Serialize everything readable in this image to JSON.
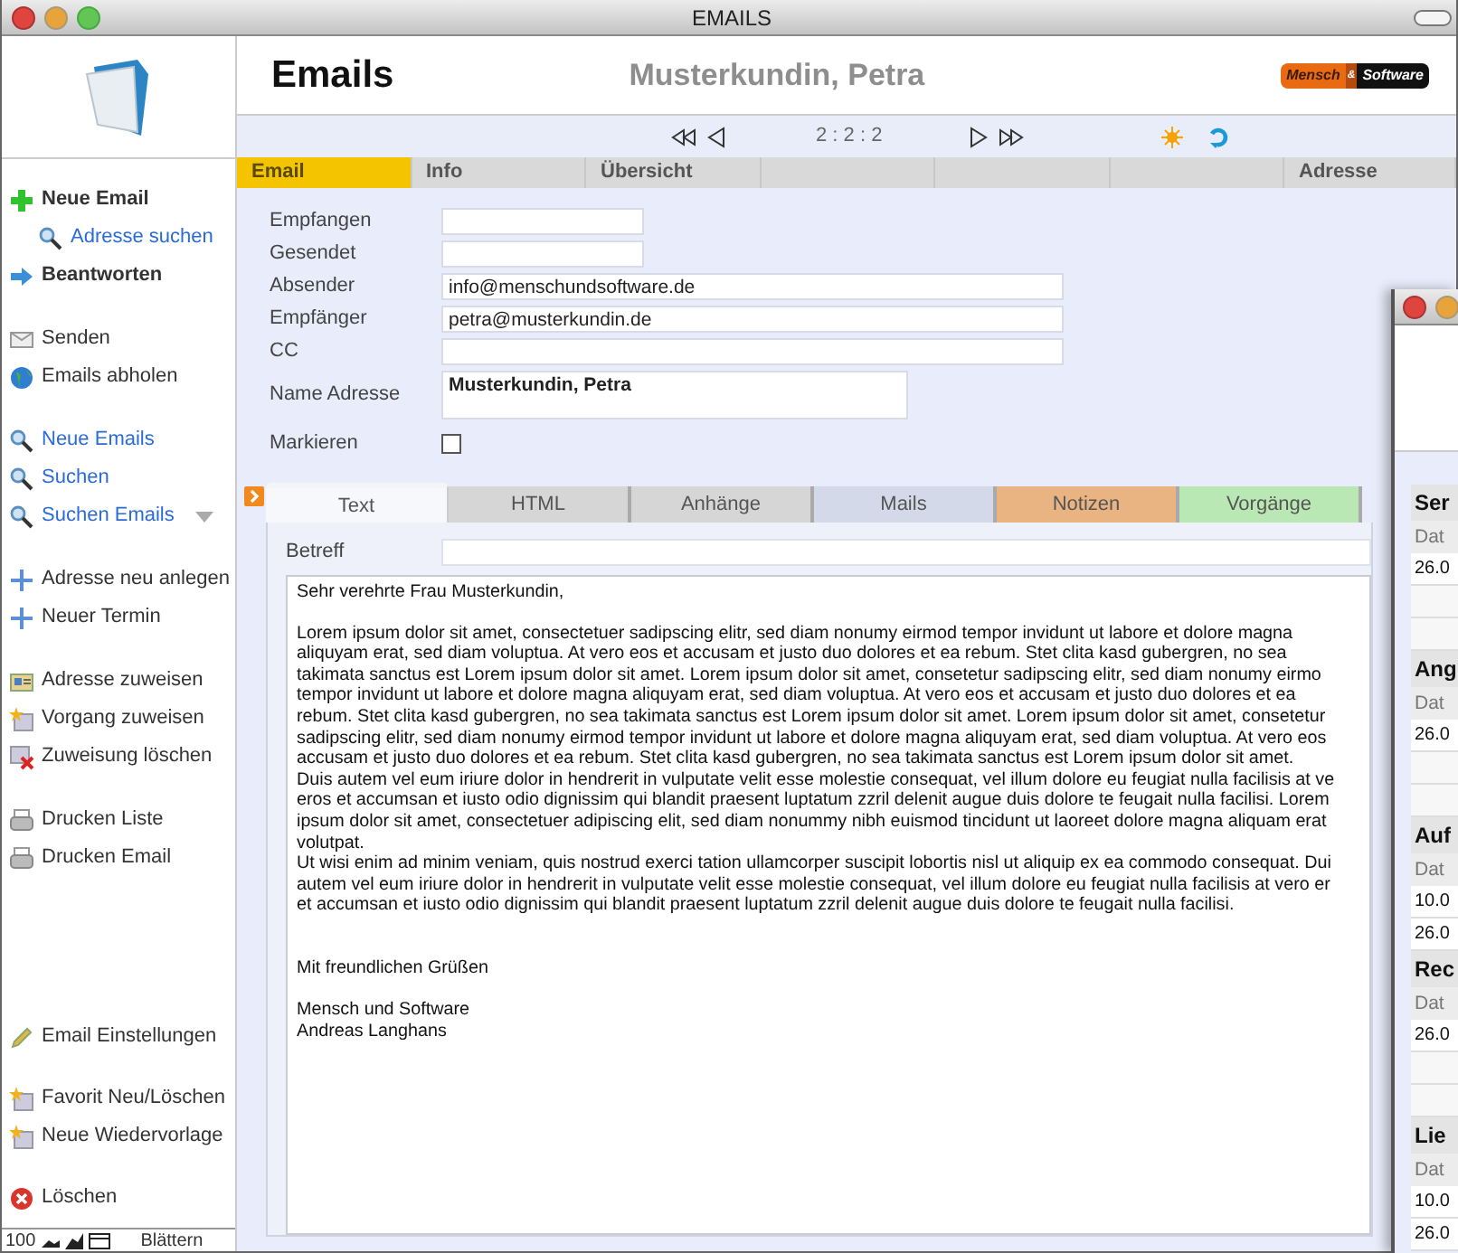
{
  "window": {
    "title": "EMAILS"
  },
  "header": {
    "title": "Emails",
    "contact": "Musterkundin, Petra",
    "logo": [
      "Mensch",
      "&",
      "Software"
    ]
  },
  "nav": {
    "record": "2 : 2 : 2"
  },
  "top_tabs": [
    {
      "label": "Email",
      "selected": true
    },
    {
      "label": "Info",
      "selected": false
    },
    {
      "label": "Übersicht",
      "selected": false
    }
  ],
  "right_tab": {
    "label": "Adresse",
    "selected": false
  },
  "sidebar": {
    "top_groups": [
      [
        {
          "label": "Neue Email",
          "kind": "add",
          "children": [
            {
              "label": "Adresse suchen",
              "kind": "search"
            }
          ]
        },
        {
          "label": "Beantworten",
          "kind": "reply"
        }
      ],
      [
        {
          "label": "Senden",
          "kind": "envelope"
        },
        {
          "label": "Emails abholen",
          "kind": "globe"
        }
      ],
      [
        {
          "label": "Neue Emails",
          "kind": "search"
        },
        {
          "label": "Suchen",
          "kind": "search"
        },
        {
          "label": "Suchen Emails",
          "kind": "search",
          "dropdown": true
        }
      ],
      [
        {
          "label": "Adresse neu anlegen",
          "kind": "cross"
        },
        {
          "label": "Neuer Termin",
          "kind": "cross"
        }
      ],
      [
        {
          "label": "Adresse zuweisen",
          "kind": "card"
        },
        {
          "label": "Vorgang zuweisen",
          "kind": "star"
        },
        {
          "label": "Zuweisung löschen",
          "kind": "unassign"
        }
      ],
      [
        {
          "label": "Drucken Liste",
          "kind": "printer"
        },
        {
          "label": "Drucken Email",
          "kind": "printer"
        }
      ]
    ],
    "bottom_groups": [
      [
        {
          "label": "Email Einstellungen",
          "kind": "pencil"
        }
      ],
      [
        {
          "label": "Favorit Neu/Löschen",
          "kind": "star"
        },
        {
          "label": "Neue Wiedervorlage",
          "kind": "star"
        }
      ],
      [
        {
          "label": "Löschen",
          "kind": "delete"
        }
      ]
    ]
  },
  "form": [
    {
      "label": "Empfangen",
      "kind": "short"
    },
    {
      "label": "Gesendet",
      "kind": "short"
    },
    {
      "label": "Absender",
      "kind": "long",
      "value": "info@menschundsoftware.de"
    },
    {
      "label": "Empfänger",
      "kind": "long",
      "value": "petra@musterkundin.de"
    },
    {
      "label": "CC",
      "kind": "long"
    },
    {
      "label": "Name Adresse",
      "kind": "area",
      "value": "Musterkundin, Petra"
    },
    {
      "label": "Markieren",
      "kind": "checkbox",
      "checked": false
    }
  ],
  "detail_tabs": [
    {
      "label": "Text",
      "selected": true,
      "color": "#f4f5f8"
    },
    {
      "label": "HTML",
      "selected": false,
      "color": "#d6d6d6"
    },
    {
      "label": "Anhänge",
      "selected": false,
      "color": "#d6d6d6"
    },
    {
      "label": "Mails",
      "selected": false,
      "color": "#d3d9e8"
    },
    {
      "label": "Notizen",
      "selected": false,
      "color": "#e9b482"
    },
    {
      "label": "Vorgänge",
      "selected": false,
      "color": "#b9e8b5"
    }
  ],
  "subject_label": "Betreff",
  "body": "Sehr verehrte Frau Musterkundin,\n\nLorem ipsum dolor sit amet, consectetuer sadipscing elitr, sed diam nonumy eirmod tempor invidunt ut labore et dolore magna\naliquyam erat, sed diam voluptua. At vero eos et accusam et justo duo dolores et ea rebum. Stet clita kasd gubergren, no sea\ntakimata sanctus est Lorem ipsum dolor sit amet. Lorem ipsum dolor sit amet, consetetur sadipscing elitr, sed diam nonumy eirmo\ntempor invidunt ut labore et dolore magna aliquyam erat, sed diam voluptua. At vero eos et accusam et justo duo dolores et ea\nrebum. Stet clita kasd gubergren, no sea takimata sanctus est Lorem ipsum dolor sit amet. Lorem ipsum dolor sit amet, consetetur\nsadipscing elitr, sed diam nonumy eirmod tempor invidunt ut labore et dolore magna aliquyam erat, sed diam voluptua. At vero eos\naccusam et justo duo dolores et ea rebum. Stet clita kasd gubergren, no sea takimata sanctus est Lorem ipsum dolor sit amet.\nDuis autem vel eum iriure dolor in hendrerit in vulputate velit esse molestie consequat, vel illum dolore eu feugiat nulla facilisis at ve\neros et accumsan et iusto odio dignissim qui blandit praesent luptatum zzril delenit augue duis dolore te feugait nulla facilisi. Lorem\nipsum dolor sit amet, consectetuer adipiscing elit, sed diam nonummy nibh euismod tincidunt ut laoreet dolore magna aliquam erat\nvolutpat.\nUt wisi enim ad minim veniam, quis nostrud exerci tation ullamcorper suscipit lobortis nisl ut aliquip ex ea commodo consequat. Dui\nautem vel eum iriure dolor in hendrerit in vulputate velit esse molestie consequat, vel illum dolore eu feugiat nulla facilisis at vero er\net accumsan et iusto odio dignissim qui blandit praesent luptatum zzril delenit augue duis dolore te feugait nulla facilisi.\n\n\nMit freundlichen Grüßen\n\nMensch und Software\nAndreas Langhans",
  "status_bar": {
    "zoom": "100",
    "mode": "Blättern"
  },
  "second_window": {
    "sections": [
      {
        "title": "Ser",
        "column_1": "Dat",
        "rows": [
          "26.0"
        ]
      },
      {
        "title": "Ang",
        "column_1": "Dat",
        "rows": [
          "26.0"
        ]
      },
      {
        "title": "Auf",
        "column_1": "Dat",
        "rows": [
          "10.0",
          "26.0"
        ]
      },
      {
        "title": "Rec",
        "column_1": "Dat",
        "rows": [
          "26.0"
        ]
      },
      {
        "title": "Lie",
        "column_1": "Dat",
        "rows": [
          "10.0",
          "26.0"
        ]
      }
    ]
  }
}
